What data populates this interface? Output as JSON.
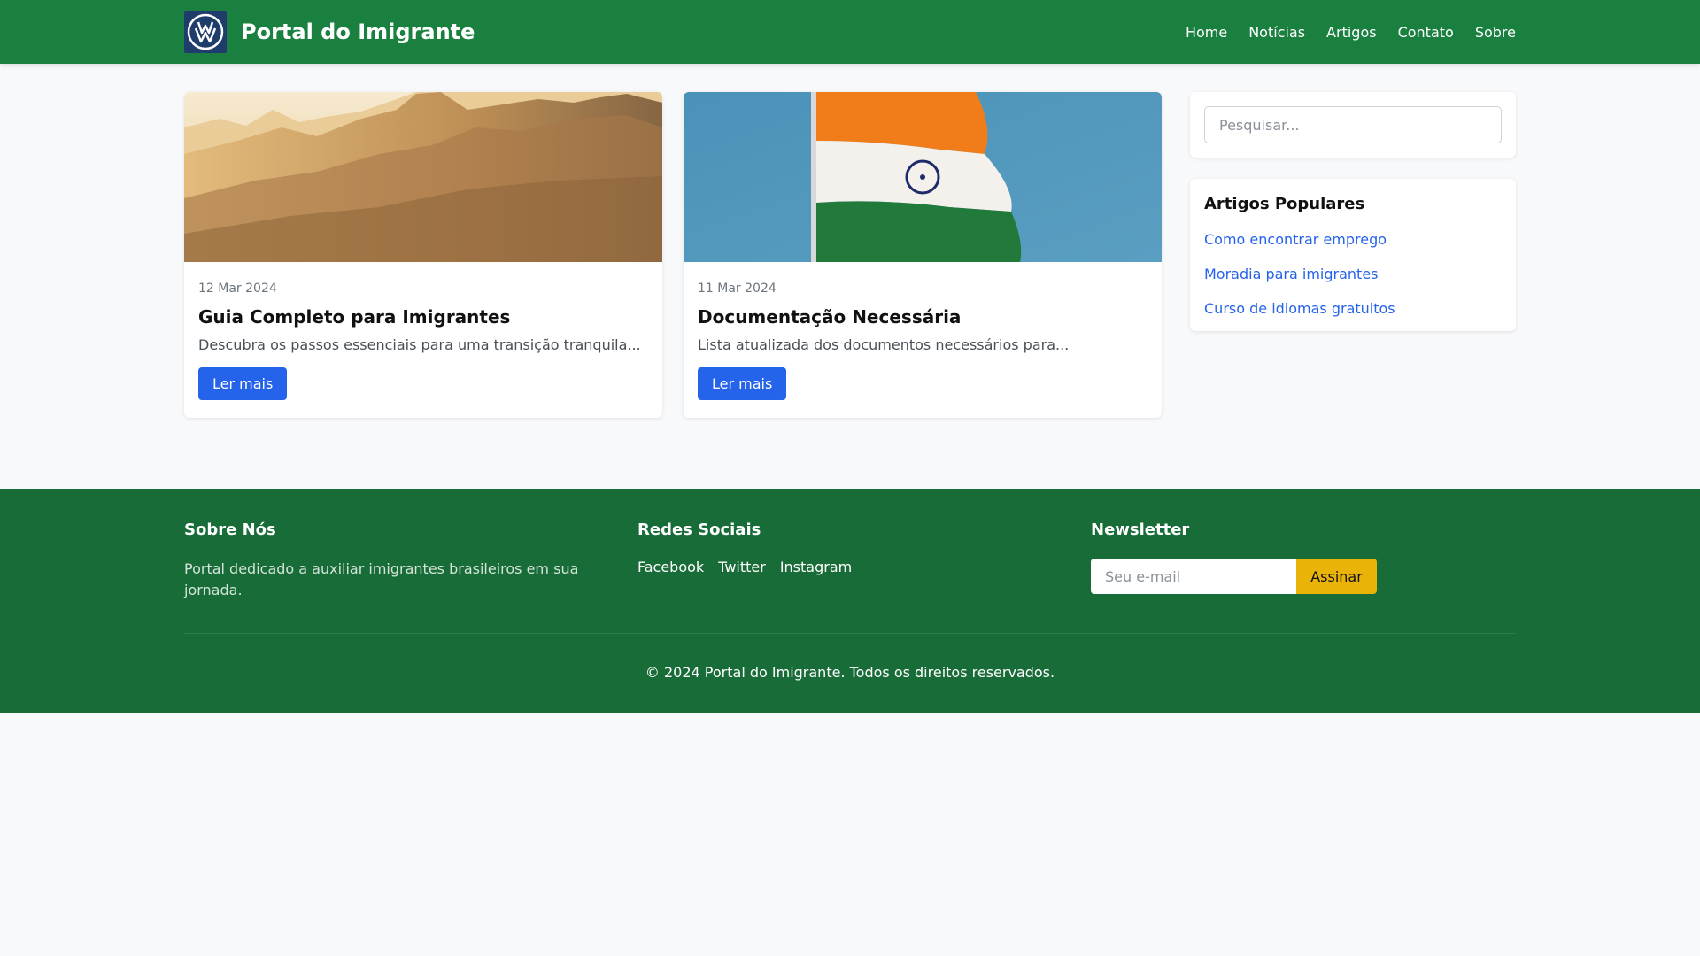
{
  "header": {
    "brand_name": "Portal do Imigrante",
    "nav": [
      "Home",
      "Notícias",
      "Artigos",
      "Contato",
      "Sobre"
    ]
  },
  "cards": [
    {
      "date": "12 Mar 2024",
      "title": "Guia Completo para Imigrantes",
      "excerpt": "Descubra os passos essenciais para uma transição tranquila...",
      "button": "Ler mais"
    },
    {
      "date": "11 Mar 2024",
      "title": "Documentação Necessária",
      "excerpt": "Lista atualizada dos documentos necessários para...",
      "button": "Ler mais"
    }
  ],
  "sidebar": {
    "search_placeholder": "Pesquisar...",
    "popular_title": "Artigos Populares",
    "popular_links": [
      "Como encontrar emprego",
      "Moradia para imigrantes",
      "Curso de idiomas gratuitos"
    ]
  },
  "footer": {
    "about_title": "Sobre Nós",
    "about_text": "Portal dedicado a auxiliar imigrantes brasileiros em sua jornada.",
    "social_title": "Redes Sociais",
    "social_links": [
      "Facebook",
      "Twitter",
      "Instagram"
    ],
    "newsletter_title": "Newsletter",
    "email_placeholder": "Seu e-mail",
    "subscribe_label": "Assinar",
    "copyright": "© 2024 Portal do Imigrante. Todos os direitos reservados."
  },
  "colors": {
    "header_green": "#198040",
    "footer_green": "#186c38",
    "primary_blue": "#2563eb",
    "subscribe_yellow": "#eab308"
  }
}
